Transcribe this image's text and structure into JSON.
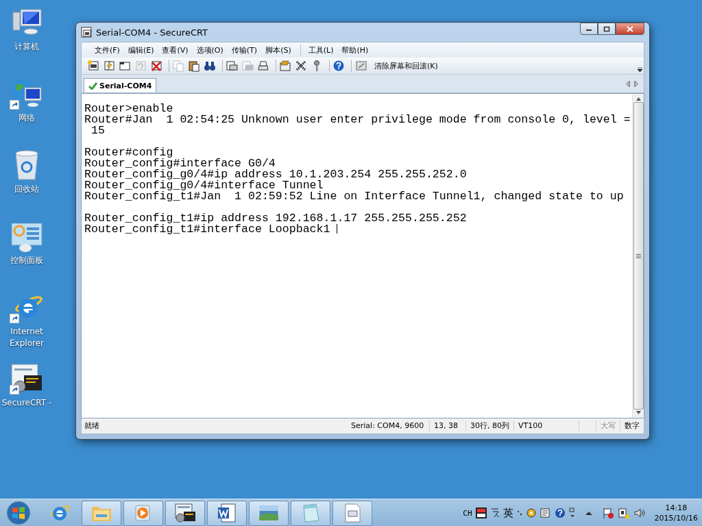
{
  "desktop_icons": [
    {
      "kind": "computer",
      "label": "计算机",
      "shortcut": false
    },
    {
      "kind": "network",
      "label": "网络",
      "shortcut": true
    },
    {
      "kind": "recycle-bin",
      "label": "回收站",
      "shortcut": false
    },
    {
      "kind": "control-panel",
      "label": "控制面板",
      "shortcut": false
    },
    {
      "kind": "browser",
      "label": "Internet Explorer",
      "shortcut": true
    },
    {
      "kind": "terminal-app",
      "label": "SecureCRT -",
      "shortcut": true
    }
  ],
  "window": {
    "title": "Serial-COM4 - SecureCRT",
    "menu": [
      "文件(F)",
      "编辑(E)",
      "查看(V)",
      "选项(O)",
      "传输(T)",
      "脚本(S)",
      "工具(L)",
      "帮助(H)"
    ],
    "toolbar": [
      {
        "kind": "connect",
        "disabled": false
      },
      {
        "kind": "quick-connect",
        "disabled": false
      },
      {
        "kind": "session-tab",
        "disabled": false
      },
      {
        "kind": "reconnect",
        "disabled": true
      },
      {
        "kind": "disconnect",
        "disabled": false
      },
      {
        "kind": "separator",
        "disabled": false
      },
      {
        "kind": "copy",
        "disabled": true
      },
      {
        "kind": "paste",
        "disabled": false
      },
      {
        "kind": "find",
        "disabled": false
      },
      {
        "kind": "separator",
        "disabled": false
      },
      {
        "kind": "print",
        "disabled": false
      },
      {
        "kind": "print",
        "disabled": true
      },
      {
        "kind": "printer",
        "disabled": false
      },
      {
        "kind": "separator",
        "disabled": false
      },
      {
        "kind": "options",
        "disabled": false
      },
      {
        "kind": "tools",
        "disabled": false
      },
      {
        "kind": "key",
        "disabled": false
      },
      {
        "kind": "separator",
        "disabled": false
      },
      {
        "kind": "help",
        "disabled": false
      },
      {
        "kind": "separator",
        "disabled": false
      }
    ],
    "clear_button": "清除屏幕和回滚(K)",
    "tabs": [
      {
        "label": "Serial-COM4",
        "selected": true,
        "connected": true
      }
    ],
    "terminal": {
      "paragraphs": [
        [
          "Router>enable",
          "Router#Jan  1 02:54:25 Unknown user enter privilege mode from console 0, level =",
          " 15"
        ],
        [
          "Router#config",
          "Router_config#interface G0/4",
          "Router_config_g0/4#ip address 10.1.203.254 255.255.252.0",
          "Router_config_g0/4#interface Tunnel",
          "Router_config_t1#Jan  1 02:59:52 Line on Interface Tunnel1, changed state to up"
        ],
        [
          "Router_config_t1#ip address 192.168.1.17 255.255.255.252",
          "Router_config_t1#interface Loopback1 "
        ]
      ],
      "cursor": true
    },
    "status_bar": {
      "message": "就绪",
      "connection": "Serial: COM4, 9600",
      "position": "13,  38",
      "size": "30行, 80列",
      "emulation": "VT100",
      "caps": {
        "label": "大写",
        "on": false
      },
      "num": {
        "label": "数字",
        "on": true
      }
    }
  },
  "taskbar": {
    "apps": [
      {
        "kind": "folder"
      },
      {
        "kind": "media"
      },
      {
        "kind": "terminal-app"
      },
      {
        "kind": "document"
      },
      {
        "kind": "image"
      },
      {
        "kind": "notepad"
      },
      {
        "kind": "window"
      }
    ],
    "tray": {
      "language": "CH",
      "ime_mode": "英",
      "time": "14:18",
      "date": "2015/10/16"
    }
  }
}
